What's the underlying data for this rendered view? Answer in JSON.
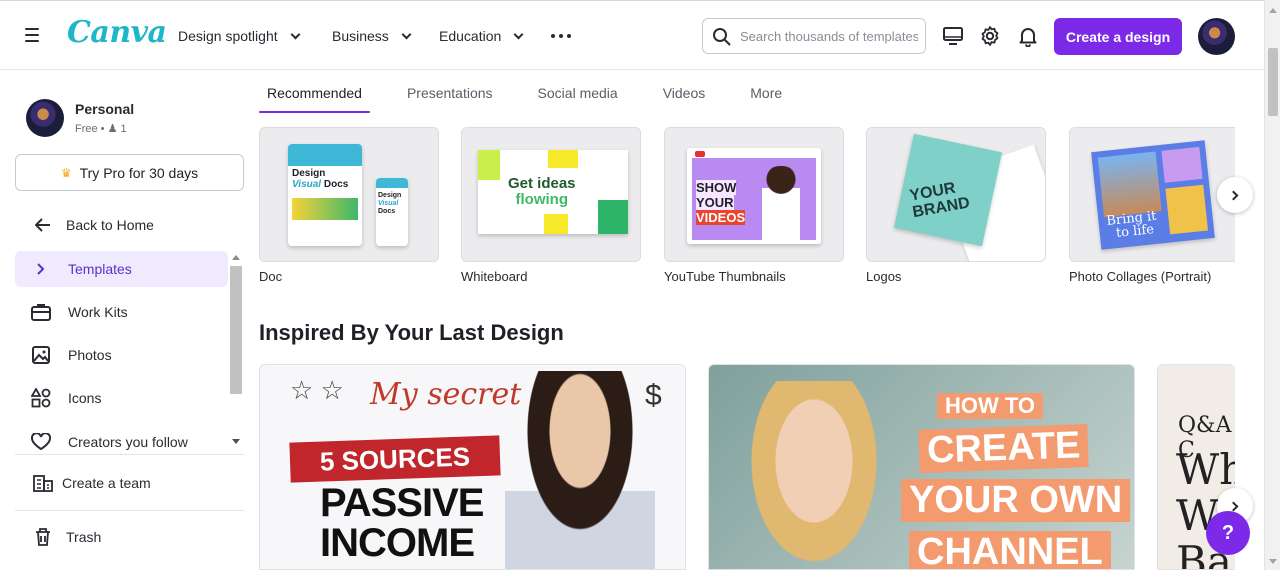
{
  "header": {
    "logo": "Canva",
    "nav": [
      {
        "label": "Design spotlight"
      },
      {
        "label": "Business"
      },
      {
        "label": "Education"
      }
    ],
    "search_placeholder": "Search thousands of templates",
    "create_label": "Create a design"
  },
  "account": {
    "name": "Personal",
    "plan": "Free",
    "members": "1",
    "try_pro": "Try Pro for 30 days"
  },
  "sidebar": {
    "back": "Back to Home",
    "items": [
      {
        "label": "Templates",
        "icon": "chevron-right-icon"
      },
      {
        "label": "Work Kits",
        "icon": "briefcase-icon"
      },
      {
        "label": "Photos",
        "icon": "image-icon"
      },
      {
        "label": "Icons",
        "icon": "shapes-icon"
      },
      {
        "label": "Creators you follow",
        "icon": "heart-icon"
      },
      {
        "label": "Create a team",
        "icon": "building-icon"
      }
    ],
    "trash": "Trash"
  },
  "tabs": [
    {
      "label": "Recommended",
      "active": true
    },
    {
      "label": "Presentations"
    },
    {
      "label": "Social media"
    },
    {
      "label": "Videos"
    },
    {
      "label": "More"
    }
  ],
  "template_cards": [
    {
      "label": "Doc",
      "art": [
        "Design",
        "Visual",
        "Docs"
      ]
    },
    {
      "label": "Whiteboard",
      "art": [
        "Get ideas",
        "flowing"
      ]
    },
    {
      "label": "YouTube Thumbnails",
      "art": [
        "SHOW",
        "YOUR",
        "VIDEOS"
      ]
    },
    {
      "label": "Logos",
      "art": [
        "YOUR",
        "BRAND"
      ]
    },
    {
      "label": "Photo Collages (Portrait)",
      "art": [
        "Bring it",
        "to life"
      ]
    }
  ],
  "section_title": "Inspired By Your Last Design",
  "designs": [
    {
      "art": [
        "My secret",
        "5 SOURCES",
        "PASSIVE",
        "INCOME"
      ]
    },
    {
      "art": [
        "HOW TO",
        "CREATE",
        "YOUR OWN",
        "CHANNEL"
      ]
    },
    {
      "art": [
        "Q&A C",
        "Wh",
        "W",
        "Ba"
      ]
    }
  ],
  "help_label": "?",
  "colors": {
    "accent": "#7d2ae8",
    "logo": "#1fb6c9"
  }
}
